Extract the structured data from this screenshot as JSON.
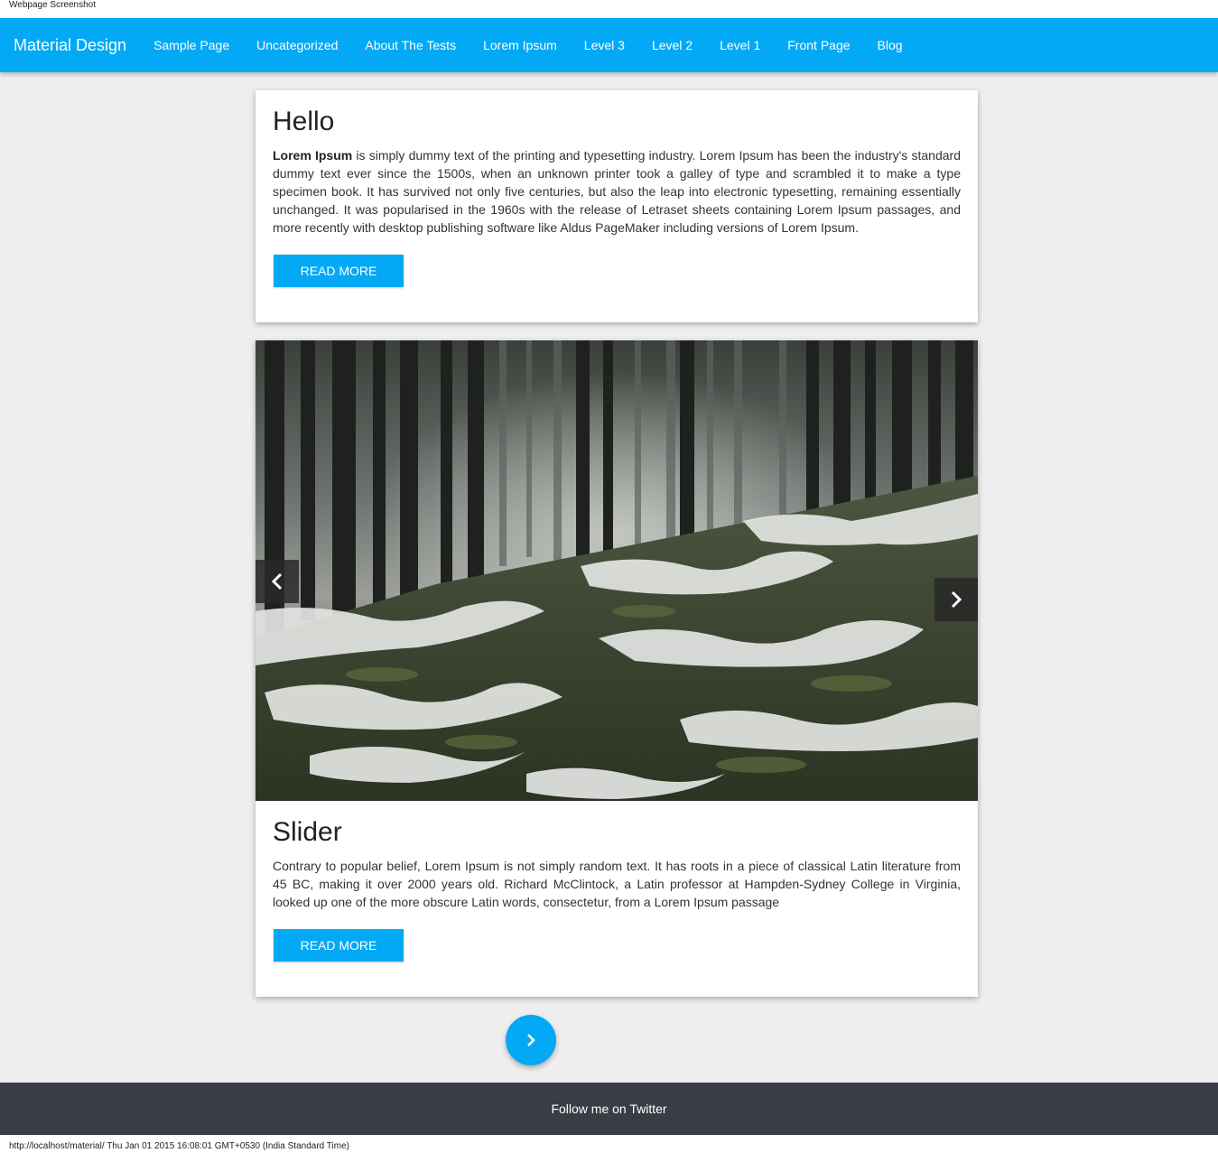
{
  "capture": {
    "header_text": "Webpage Screenshot",
    "footer_text": "http://localhost/material/ Thu Jan 01 2015 16:08:01 GMT+0530 (India Standard Time)"
  },
  "nav": {
    "brand": "Material Design",
    "items": [
      {
        "label": "Sample Page"
      },
      {
        "label": "Uncategorized"
      },
      {
        "label": "About The Tests"
      },
      {
        "label": "Lorem Ipsum"
      },
      {
        "label": "Level 3"
      },
      {
        "label": "Level 2"
      },
      {
        "label": "Level 1"
      },
      {
        "label": "Front Page"
      },
      {
        "label": "Blog"
      }
    ]
  },
  "posts": [
    {
      "title": "Hello",
      "lead_bold": "Lorem Ipsum",
      "text": " is simply dummy text of the printing and typesetting industry. Lorem Ipsum has been the industry's standard dummy text ever since the 1500s, when an unknown printer took a galley of type and scrambled it to make a type specimen book. It has survived not only five centuries, but also the leap into electronic typesetting, remaining essentially unchanged. It was popularised in the 1960s with the release of Letraset sheets containing Lorem Ipsum passages, and more recently with desktop publishing software like Aldus PageMaker including versions of Lorem Ipsum.",
      "button": "READ MORE"
    },
    {
      "title": "Slider",
      "text": "Contrary to popular belief, Lorem Ipsum is not simply random text. It has roots in a piece of classical Latin literature from 45 BC, making it over 2000 years old. Richard McClintock, a Latin professor at Hampden-Sydney College in Virginia, looked up one of the more obscure Latin words, consectetur, from a Lorem Ipsum passage",
      "button": "READ MORE"
    }
  ],
  "slider": {
    "prev_icon": "chevron-left-icon",
    "next_icon": "chevron-right-icon"
  },
  "pagination": {
    "next_icon": "chevron-right-icon"
  },
  "footer": {
    "text": "Follow me on Twitter"
  },
  "colors": {
    "accent": "#03a9f4",
    "background": "#eeeeee",
    "footer": "#393e46"
  }
}
